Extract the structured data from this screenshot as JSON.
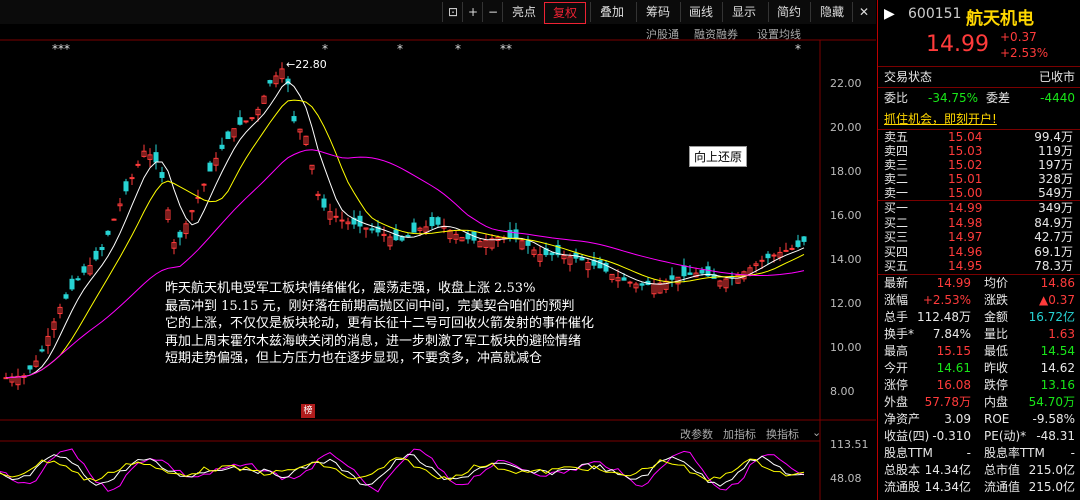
{
  "toolbar": {
    "items": [
      "亮点",
      "复权",
      "叠加",
      "筹码",
      "画线",
      "显示",
      "简约",
      "隐藏"
    ],
    "icons": [
      "restore-icon",
      "zoom-in-icon",
      "zoom-out-icon"
    ],
    "active": "复权"
  },
  "subbar": {
    "items": [
      "沪股通",
      "融资融券",
      "设置均线"
    ]
  },
  "chart": {
    "max_label": "22.80",
    "y_ticks": [
      "22.00",
      "20.00",
      "18.00",
      "16.00",
      "14.00",
      "12.00",
      "10.00",
      "8.00"
    ],
    "indicator_ticks": [
      "113.51",
      "48.08"
    ],
    "star_markers": [
      "***",
      "*",
      "*",
      "**",
      "*",
      "*"
    ],
    "tooltip": "向上还原",
    "bang_label": "榜"
  },
  "chart_data": {
    "type": "candlestick",
    "ylim": [
      7.5,
      23.5
    ],
    "ma_colors": [
      "#ffffff",
      "#ffff00",
      "#ff00ff"
    ]
  },
  "annotation": {
    "lines": [
      "昨天航天机电受军工板块情绪催化，震荡走强，收盘上涨 2.53%",
      "最高冲到 15.15 元，刚好落在前期高抛区间中间，完美契合咱们的预判",
      "它的上涨，不仅仅是板块轮动，更有长征十二号可回收火箭发射的事件催化",
      "再加上周末霍尔木兹海峡关闭的消息，进一步刺激了军工板块的避险情绪",
      "短期走势偏强，但上方压力也在逐步显现，不要贪多，冲高就减仓"
    ]
  },
  "indicator_bar": {
    "items": [
      "改参数",
      "加指标",
      "换指标"
    ]
  },
  "stock": {
    "code": "600151",
    "name": "航天机电",
    "price": "14.99",
    "change": "+0.37",
    "pct": "+2.53%",
    "status_label": "交易状态",
    "status_value": "已收市",
    "weibi_label": "委比",
    "weibi_value": "-34.75%",
    "weicha_label": "委差",
    "weicha_value": "-4440",
    "banner": "抓住机会，即刻开户!"
  },
  "sells": [
    {
      "label": "卖五",
      "price": "15.04",
      "vol": "99.4万"
    },
    {
      "label": "卖四",
      "price": "15.03",
      "vol": "119万"
    },
    {
      "label": "卖三",
      "price": "15.02",
      "vol": "197万"
    },
    {
      "label": "卖二",
      "price": "15.01",
      "vol": "328万"
    },
    {
      "label": "卖一",
      "price": "15.00",
      "vol": "549万"
    }
  ],
  "buys": [
    {
      "label": "买一",
      "price": "14.99",
      "vol": "349万"
    },
    {
      "label": "买二",
      "price": "14.98",
      "vol": "84.9万"
    },
    {
      "label": "买三",
      "price": "14.97",
      "vol": "42.7万"
    },
    {
      "label": "买四",
      "price": "14.96",
      "vol": "69.1万"
    },
    {
      "label": "买五",
      "price": "14.95",
      "vol": "78.3万"
    }
  ],
  "stats": [
    {
      "l1": "最新",
      "v1": "14.99",
      "c1": "red",
      "l2": "均价",
      "v2": "14.86",
      "c2": "red"
    },
    {
      "l1": "涨幅",
      "v1": "+2.53%",
      "c1": "red",
      "l2": "涨跌",
      "v2": "▲0.37",
      "c2": "red"
    },
    {
      "l1": "总手",
      "v1": "112.48万",
      "c1": "white",
      "l2": "金额",
      "v2": "16.72亿",
      "c2": "cyan"
    },
    {
      "l1": "换手*",
      "v1": "7.84%",
      "c1": "white",
      "l2": "量比",
      "v2": "1.63",
      "c2": "red"
    },
    {
      "l1": "最高",
      "v1": "15.15",
      "c1": "red",
      "l2": "最低",
      "v2": "14.54",
      "c2": "green"
    },
    {
      "l1": "今开",
      "v1": "14.61",
      "c1": "green",
      "l2": "昨收",
      "v2": "14.62",
      "c2": "white"
    },
    {
      "l1": "涨停",
      "v1": "16.08",
      "c1": "red",
      "l2": "跌停",
      "v2": "13.16",
      "c2": "green"
    },
    {
      "l1": "外盘",
      "v1": "57.78万",
      "c1": "red",
      "l2": "内盘",
      "v2": "54.70万",
      "c2": "green"
    },
    {
      "l1": "净资产",
      "v1": "3.09",
      "c1": "white",
      "l2": "ROE",
      "v2": "-9.58%",
      "c2": "white"
    },
    {
      "l1": "收益(四)",
      "v1": "-0.310",
      "c1": "white",
      "l2": "PE(动)*",
      "v2": "-48.31",
      "c2": "white"
    },
    {
      "l1": "股息TTM",
      "v1": "-",
      "c1": "white",
      "l2": "股息率TTM",
      "v2": "-",
      "c2": "white"
    },
    {
      "l1": "总股本",
      "v1": "14.34亿",
      "c1": "white",
      "l2": "总市值",
      "v2": "215.0亿",
      "c2": "white"
    },
    {
      "l1": "流通股",
      "v1": "14.34亿",
      "c1": "white",
      "l2": "流通值",
      "v2": "215.0亿",
      "c2": "white"
    }
  ]
}
